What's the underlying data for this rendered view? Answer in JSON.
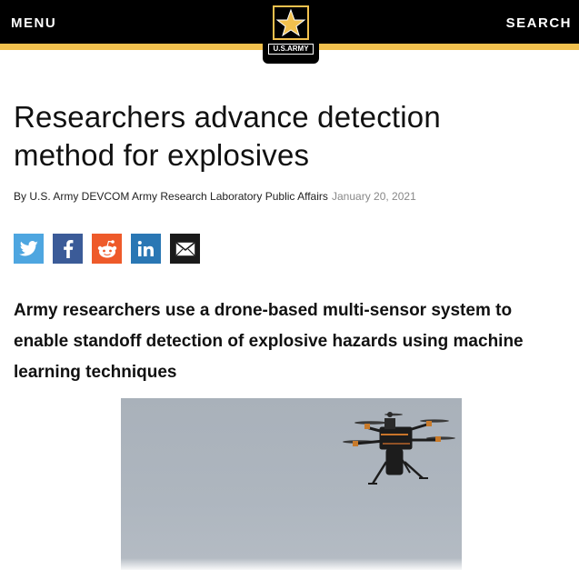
{
  "header": {
    "menu_label": "MENU",
    "search_label": "SEARCH",
    "logo_text": "U.S.ARMY"
  },
  "article": {
    "title": "Researchers advance detection method for explosives",
    "byline": "By U.S. Army DEVCOM Army Research Laboratory Public Affairs",
    "date": "January 20, 2021",
    "deck": "Army researchers use a drone-based multi-sensor system to enable standoff detection of explosive hazards using machine learning techniques"
  },
  "share": [
    {
      "name": "twitter",
      "icon": "twitter-icon",
      "color": "#4ea6e0"
    },
    {
      "name": "facebook",
      "icon": "facebook-icon",
      "color": "#3b5b98"
    },
    {
      "name": "reddit",
      "icon": "reddit-icon",
      "color": "#ee5a2a"
    },
    {
      "name": "linkedin",
      "icon": "linkedin-icon",
      "color": "#2a77b4"
    },
    {
      "name": "email",
      "icon": "email-icon",
      "color": "#1a1a1a"
    }
  ],
  "colors": {
    "header_bg": "#000000",
    "accent_gold": "#f2c14e",
    "sky": "#aeb6bf"
  }
}
